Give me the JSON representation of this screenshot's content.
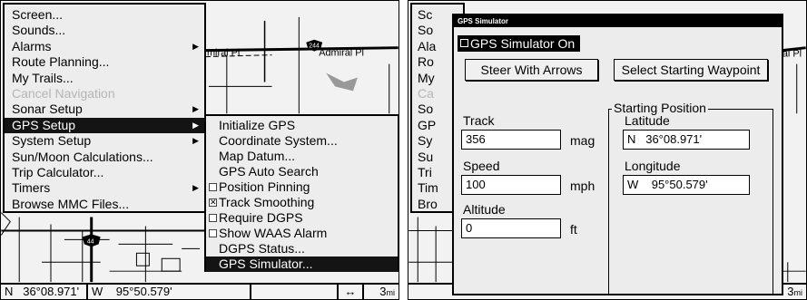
{
  "left": {
    "menu": [
      {
        "label": "Screen...",
        "submenu": false,
        "disabled": false,
        "selected": false
      },
      {
        "label": "Sounds...",
        "submenu": false,
        "disabled": false,
        "selected": false
      },
      {
        "label": "Alarms",
        "submenu": true,
        "disabled": false,
        "selected": false
      },
      {
        "label": "Route Planning...",
        "submenu": false,
        "disabled": false,
        "selected": false
      },
      {
        "label": "My Trails...",
        "submenu": false,
        "disabled": false,
        "selected": false
      },
      {
        "label": "Cancel Navigation",
        "submenu": false,
        "disabled": true,
        "selected": false
      },
      {
        "label": "Sonar Setup",
        "submenu": true,
        "disabled": false,
        "selected": false
      },
      {
        "label": "GPS Setup",
        "submenu": true,
        "disabled": false,
        "selected": true
      },
      {
        "label": "System Setup",
        "submenu": true,
        "disabled": false,
        "selected": false
      },
      {
        "label": "Sun/Moon Calculations...",
        "submenu": false,
        "disabled": false,
        "selected": false
      },
      {
        "label": "Trip Calculator...",
        "submenu": false,
        "disabled": false,
        "selected": false
      },
      {
        "label": "Timers",
        "submenu": true,
        "disabled": false,
        "selected": false
      },
      {
        "label": "Browse MMC Files...",
        "submenu": false,
        "disabled": false,
        "selected": false
      }
    ],
    "submenu": [
      {
        "label": "Initialize GPS",
        "checkbox": null,
        "selected": false
      },
      {
        "label": "Coordinate System...",
        "checkbox": null,
        "selected": false
      },
      {
        "label": "Map Datum...",
        "checkbox": null,
        "selected": false
      },
      {
        "label": "GPS Auto Search",
        "checkbox": null,
        "selected": false
      },
      {
        "label": "Position Pinning",
        "checkbox": false,
        "selected": false
      },
      {
        "label": "Track Smoothing",
        "checkbox": true,
        "selected": false
      },
      {
        "label": "Require DGPS",
        "checkbox": false,
        "selected": false
      },
      {
        "label": "Show WAAS Alarm",
        "checkbox": false,
        "selected": false
      },
      {
        "label": "DGPS Status...",
        "checkbox": null,
        "selected": false
      },
      {
        "label": "GPS Simulator...",
        "checkbox": null,
        "selected": true
      }
    ],
    "map_labels": {
      "road": "Admiral Pl",
      "road_partial": "miral Pl",
      "shield_top": "244",
      "shield_bottom": "44"
    },
    "status": {
      "lat": "N   36°08.971'",
      "lon": "W    95°50.579'",
      "arrow": "↔",
      "scale": "3",
      "scale_unit": "mi"
    }
  },
  "right": {
    "menu_partial": [
      "Sc",
      "So",
      "Ala",
      "Ro",
      "My",
      "Ca",
      "So",
      "GP",
      "Sy",
      "Su",
      "Tri",
      "Tim",
      "Bro"
    ],
    "map_labels": {
      "road_partial": "al Pl"
    },
    "status": {
      "scale": "3",
      "scale_unit": "mi"
    },
    "dialog": {
      "title": "GPS Simulator",
      "simulator_on_label": "GPS Simulator On",
      "steer_button": "Steer With Arrows",
      "waypoint_button": "Select Starting Waypoint",
      "track_label": "Track",
      "track_value": "356",
      "track_unit": "mag",
      "speed_label": "Speed",
      "speed_value": "100",
      "speed_unit": "mph",
      "altitude_label": "Altitude",
      "altitude_value": "0",
      "altitude_unit": "ft",
      "starting_position_label": "Starting Position",
      "latitude_label": "Latitude",
      "latitude_value": "N   36°08.971'",
      "longitude_label": "Longitude",
      "longitude_value": "W    95°50.579'"
    }
  }
}
